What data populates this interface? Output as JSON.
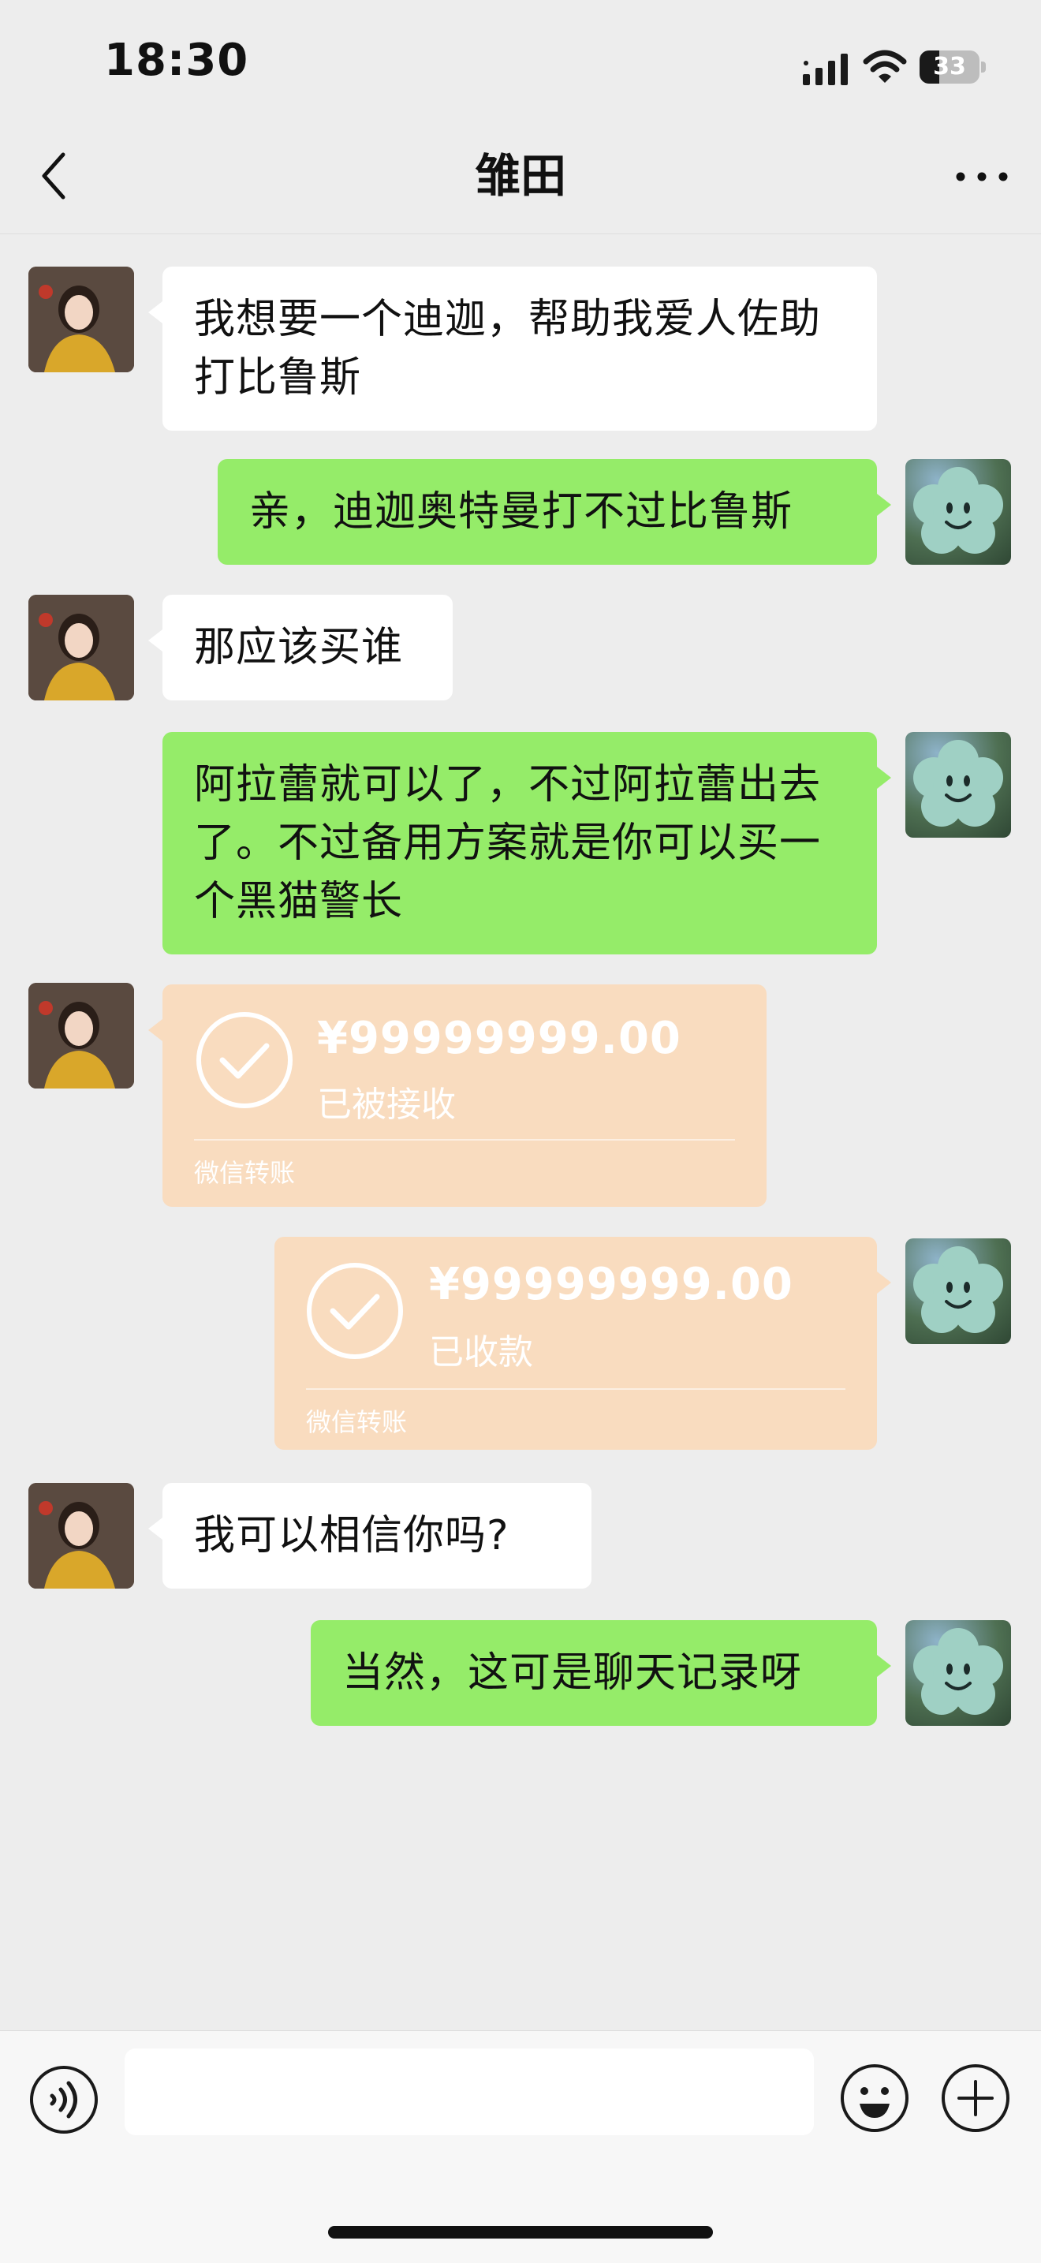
{
  "status_bar": {
    "time": "18:30",
    "battery": "33",
    "battery_level": 0.33
  },
  "header": {
    "title": "雏田"
  },
  "messages": [
    {
      "side": "left",
      "type": "text",
      "text": "我想要一个迪迦，帮助我爱人佐助打比鲁斯"
    },
    {
      "side": "right",
      "type": "text",
      "text": "亲，迪迦奥特曼打不过比鲁斯"
    },
    {
      "side": "left",
      "type": "text",
      "text": "那应该买谁"
    },
    {
      "side": "right",
      "type": "text",
      "text": "阿拉蕾就可以了，不过阿拉蕾出去了。不过备用方案就是你可以买一个黑猫警长"
    },
    {
      "side": "left",
      "type": "transfer",
      "amount": "¥99999999.00",
      "status": "已被接收",
      "label": "微信转账"
    },
    {
      "side": "right",
      "type": "transfer",
      "amount": "¥99999999.00",
      "status": "已收款",
      "label": "微信转账"
    },
    {
      "side": "left",
      "type": "text",
      "text": "我可以相信你吗?"
    },
    {
      "side": "right",
      "type": "text",
      "text": "当然，这可是聊天记录呀"
    }
  ],
  "input": {
    "value": ""
  },
  "icons": {
    "back": "chevron-left-icon",
    "more": "ellipsis-icon",
    "voice": "voice-icon",
    "emoji": "emoji-icon",
    "plus": "plus-icon"
  },
  "colors": {
    "background": "#ededed",
    "bubble_self": "#95ec69",
    "bubble_other": "#ffffff",
    "transfer_done": "#f9dcbf"
  }
}
